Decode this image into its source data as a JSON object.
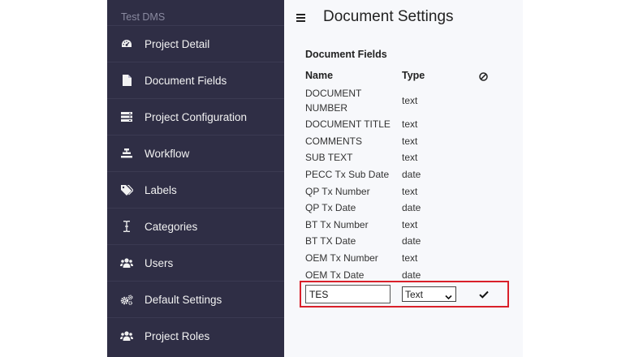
{
  "sidebar": {
    "title": "Test DMS",
    "items": [
      {
        "label": "Project Detail",
        "icon": "dashboard-icon"
      },
      {
        "label": "Document Fields",
        "icon": "file-icon"
      },
      {
        "label": "Project Configuration",
        "icon": "server-icon"
      },
      {
        "label": "Workflow",
        "icon": "workflow-icon"
      },
      {
        "label": "Labels",
        "icon": "tags-icon"
      },
      {
        "label": "Categories",
        "icon": "i-cursor-icon"
      },
      {
        "label": "Users",
        "icon": "users-icon"
      },
      {
        "label": "Default Settings",
        "icon": "cogs-icon"
      },
      {
        "label": "Project Roles",
        "icon": "users-icon"
      }
    ]
  },
  "header": {
    "title": "Document Settings",
    "menu_icon": "hamburger-icon"
  },
  "fields_table": {
    "title": "Document Fields",
    "columns": {
      "name": "Name",
      "type": "Type",
      "disabled_icon": "ban-icon"
    },
    "rows": [
      {
        "name": "DOCUMENT NUMBER",
        "type": "text"
      },
      {
        "name": "DOCUMENT TITLE",
        "type": "text"
      },
      {
        "name": "COMMENTS",
        "type": "text"
      },
      {
        "name": "SUB TEXT",
        "type": "text"
      },
      {
        "name": "PECC Tx Sub Date",
        "type": "date"
      },
      {
        "name": "QP Tx Number",
        "type": "text"
      },
      {
        "name": "QP Tx Date",
        "type": "date"
      },
      {
        "name": "BT Tx Number",
        "type": "text"
      },
      {
        "name": "BT TX Date",
        "type": "date"
      },
      {
        "name": "OEM Tx Number",
        "type": "text"
      },
      {
        "name": "OEM Tx Date",
        "type": "date"
      }
    ]
  },
  "new_field": {
    "name_value": "TES",
    "type_selected": "Text",
    "confirm_icon": "check-icon"
  },
  "colors": {
    "sidebar_bg": "#2f2e45",
    "main_bg": "#f7f8fb",
    "highlight": "#d9202a"
  }
}
